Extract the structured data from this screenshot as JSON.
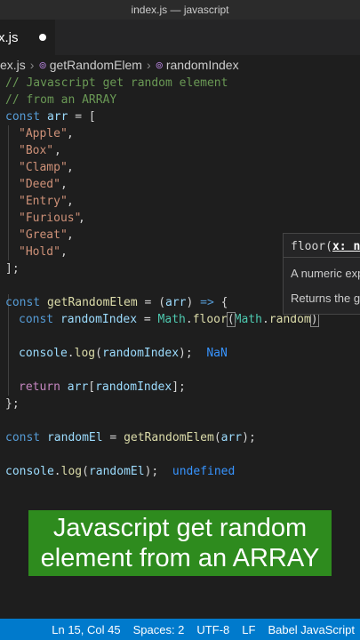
{
  "window": {
    "title": "index.js — javascript"
  },
  "tab": {
    "label": "x.js"
  },
  "breadcrumbs": {
    "file": "ex.js",
    "func": "getRandomElem",
    "var": "randomIndex"
  },
  "code": {
    "comment1": "// Javascript get random element",
    "comment2": "// from an ARRAY",
    "items": [
      "\"Apple\"",
      "\"Box\"",
      "\"Clamp\"",
      "\"Deed\"",
      "\"Entry\"",
      "\"Furious\"",
      "\"Great\"",
      "\"Hold\""
    ],
    "inlay_nan": "NaN",
    "inlay_undefined": "undefined"
  },
  "hover": {
    "signature_fn": "floor(",
    "signature_param": "x: n",
    "desc1": "A numeric exp",
    "desc2": "Returns the g"
  },
  "caption": {
    "line1": "Javascript get random",
    "line2": "element from an ARRAY"
  },
  "status": {
    "position": "Ln 15, Col 45",
    "spaces": "Spaces: 2",
    "encoding": "UTF-8",
    "eol": "LF",
    "language": "Babel JavaScript"
  }
}
